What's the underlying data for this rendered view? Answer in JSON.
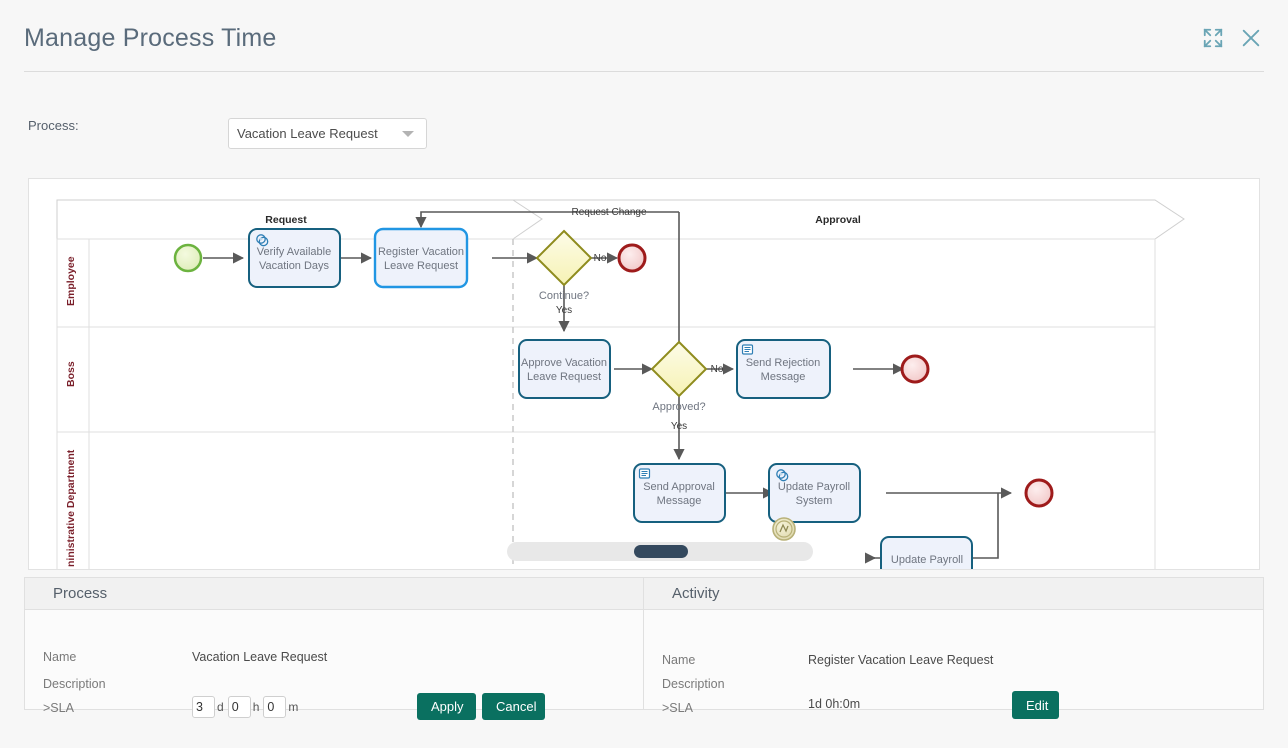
{
  "header": {
    "title": "Manage Process Time",
    "expand_icon": "expand-icon",
    "close_icon": "close-icon"
  },
  "process_selector": {
    "label": "Process:",
    "value": "Vacation Leave Request",
    "caret_icon": "chevron-down-icon"
  },
  "diagram": {
    "lanes": [
      {
        "label": "Employee"
      },
      {
        "label": "Boss"
      },
      {
        "label": "ninistrative Department"
      }
    ],
    "phases": [
      {
        "label": "Request"
      },
      {
        "label": "Approval"
      }
    ],
    "tasks": [
      {
        "id": "verify",
        "line1": "Verify Available",
        "line2": "Vacation Days",
        "icon": "service-task-gear-icon",
        "selected": false
      },
      {
        "id": "register",
        "line1": "Register Vacation",
        "line2": "Leave Request",
        "icon": "",
        "selected": true
      },
      {
        "id": "approve",
        "line1": "Approve Vacation",
        "line2": "Leave Request",
        "icon": "",
        "selected": false
      },
      {
        "id": "reject-msg",
        "line1": "Send Rejection",
        "line2": "Message",
        "icon": "send-task-message-icon",
        "selected": false
      },
      {
        "id": "approval-msg",
        "line1": "Send Approval",
        "line2": "Message",
        "icon": "send-task-message-icon",
        "selected": false
      },
      {
        "id": "payroll",
        "line1": "Update Payroll",
        "line2": "System",
        "icon": "service-task-gear-icon",
        "selected": false
      },
      {
        "id": "payroll2",
        "line1": "Update Payroll",
        "line2": "",
        "icon": "",
        "selected": false
      }
    ],
    "gateways": [
      {
        "id": "continue",
        "label": "Continue?"
      },
      {
        "id": "approved",
        "label": "Approved?"
      }
    ],
    "flow_labels": [
      {
        "id": "request-change",
        "text": "Request Change"
      },
      {
        "id": "continue-no",
        "text": "No"
      },
      {
        "id": "continue-yes",
        "text": "Yes"
      },
      {
        "id": "approved-no",
        "text": "No"
      },
      {
        "id": "approved-yes",
        "text": "Yes"
      }
    ],
    "events": [
      {
        "id": "start",
        "type": "start-event"
      },
      {
        "id": "end-1",
        "type": "end-event"
      },
      {
        "id": "end-2",
        "type": "end-event"
      },
      {
        "id": "end-3",
        "type": "end-event"
      },
      {
        "id": "boundary-error",
        "type": "boundary-event-icon"
      }
    ],
    "colors": {
      "task_border": "#16607f",
      "task_selected_border": "#2196e3",
      "task_fill": "#eef2fb",
      "gateway_border": "#8f8c1e",
      "gateway_fill": "#fbf8c8",
      "start_event": "#6cb33f",
      "end_event": "#9e1b1b",
      "lane_label": "#7a1f2a"
    }
  },
  "scrollbar": {
    "name": "horizontal-scrollbar"
  },
  "panels": [
    {
      "title": "Process",
      "fields": [
        {
          "label": "Name",
          "value": "Vacation Leave Request"
        },
        {
          "label": "Description",
          "value": ""
        },
        {
          "label": ">SLA",
          "value": ""
        }
      ],
      "sla": {
        "days": "3",
        "days_unit": "d",
        "hours": "0",
        "hours_unit": "h",
        "minutes": "0",
        "minutes_unit": "m"
      },
      "buttons": [
        {
          "id": "apply",
          "label": "Apply"
        },
        {
          "id": "cancel",
          "label": "Cancel"
        }
      ]
    },
    {
      "title": "Activity",
      "fields": [
        {
          "label": "Name",
          "value": "Register Vacation Leave Request"
        },
        {
          "label": "Description",
          "value": ""
        },
        {
          "label": ">SLA",
          "value": "1d 0h:0m"
        }
      ],
      "buttons": [
        {
          "id": "edit",
          "label": "Edit"
        }
      ]
    }
  ]
}
